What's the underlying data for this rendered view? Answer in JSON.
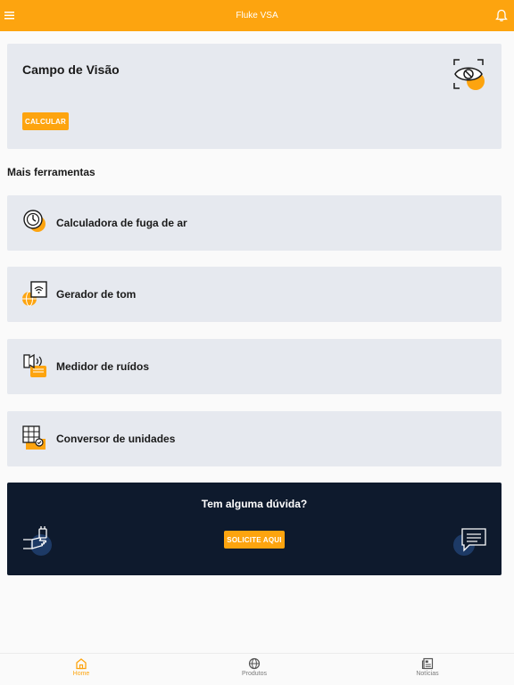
{
  "app": {
    "title": "Fluke VSA"
  },
  "colors": {
    "accent": "#fda40f",
    "card_bg": "#e6e9ef",
    "help_bg": "#0e1a2d"
  },
  "hero": {
    "title": "Campo de Visão",
    "button_label": "CALCULAR",
    "icon": "eye-target-icon"
  },
  "section": {
    "title": "Mais ferramentas"
  },
  "tools": [
    {
      "label": "Calculadora de fuga de ar",
      "icon": "gauge-clock-icon"
    },
    {
      "label": "Gerador de tom",
      "icon": "tone-generator-icon"
    },
    {
      "label": "Medidor de ruídos",
      "icon": "noise-meter-icon"
    },
    {
      "label": "Conversor de unidades",
      "icon": "unit-converter-icon"
    }
  ],
  "help": {
    "title": "Tem alguma dúvida?",
    "button_label": "SOLICITE AQUI",
    "left_icon": "plug-hand-icon",
    "right_icon": "chat-bubbles-icon"
  },
  "nav": {
    "items": [
      {
        "label": "Home",
        "icon": "home-icon",
        "active": true
      },
      {
        "label": "Produtos",
        "icon": "globe-icon",
        "active": false
      },
      {
        "label": "Notícias",
        "icon": "newspaper-icon",
        "active": false
      }
    ]
  }
}
